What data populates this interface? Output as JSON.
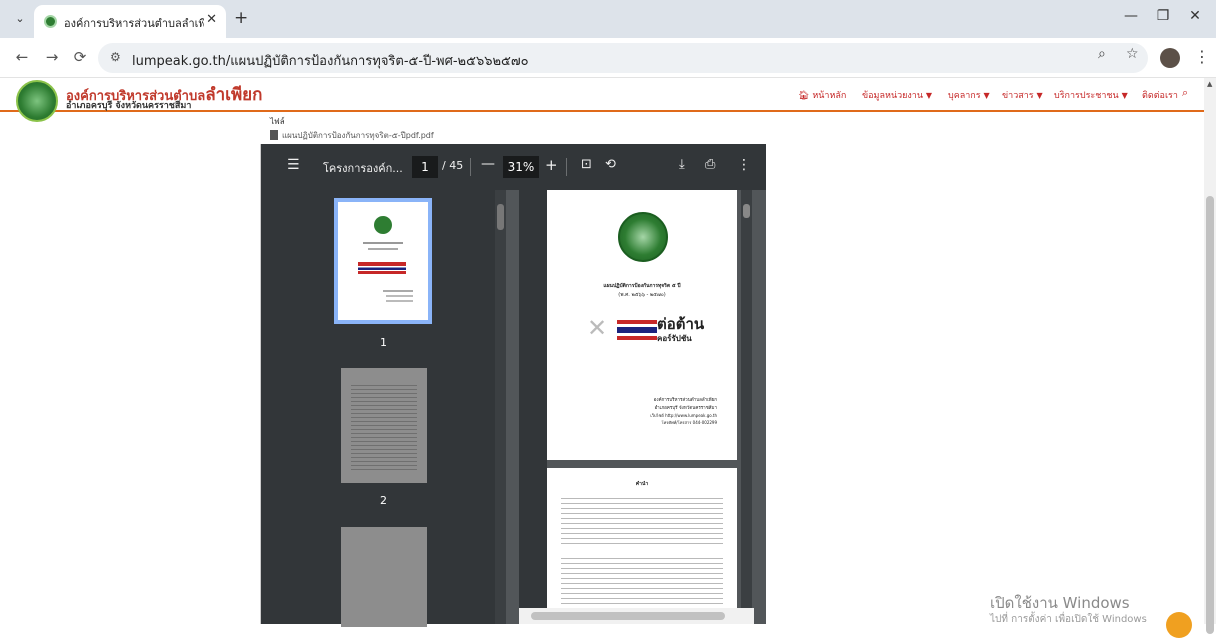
{
  "browser": {
    "tab_title": "องค์การบริหารส่วนตำบลลำเพียก - ลำ",
    "tab_dropdown_icon": "chevron-down-icon",
    "url": "lumpeak.go.th/แผนปฏิบัติการป้องกันการทุจริต-๕-ปี-พศ-๒๕๖๖๒๕๗๐",
    "minimize": "—",
    "restore": "❐",
    "close": "✕"
  },
  "site": {
    "org_name_prefix": "องค์การบริหารส่วนตำบล",
    "org_name_big": "ลำเพียก",
    "org_sub": "อำเภอครบุรี จังหวัดนครราชสีมา",
    "nav": {
      "home": "หน้าหลัก",
      "agency": "ข้อมูลหน่วยงาน",
      "personnel": "บุคลากร",
      "news": "ข่าวสาร",
      "services": "บริการประชาชน",
      "contact": "ติดต่อเรา"
    },
    "accent": "#c62828"
  },
  "file": {
    "label": "ไฟล์",
    "name": "แผนปฏิบัติการป้องกันการทุจริต-๕-ปีpdf.pdf"
  },
  "pdf": {
    "doc_title": "โครงการองค์ก...",
    "current_page": "1",
    "total_pages": "/ 45",
    "zoom": "31%",
    "thumbnails": [
      "1",
      "2"
    ]
  },
  "page1": {
    "plan_title": "แผนปฏิบัติการป้องกันการทุจริต ๕ ปี",
    "plan_years": "(พ.ศ. ๒๕๖๖ - ๒๕๗๐)",
    "banner_big": "ต่อต้าน",
    "banner_small": "คอร์รัปชัน",
    "org": "องค์การบริหารส่วนตำบลลำเพียก",
    "district": "อำเภอครบุรี จังหวัดนครราชสีมา",
    "website": "เว็บไซต์ http://www.lumpeak.go.th",
    "phone": "โทรศัพท์/โทรสาร 044-002299"
  },
  "page2": {
    "heading": "คำนำ"
  },
  "windows": {
    "activate_title": "เปิดใช้งาน Windows",
    "activate_sub": "ไปที่ การตั้งค่า เพื่อเปิดใช้ Windows"
  }
}
